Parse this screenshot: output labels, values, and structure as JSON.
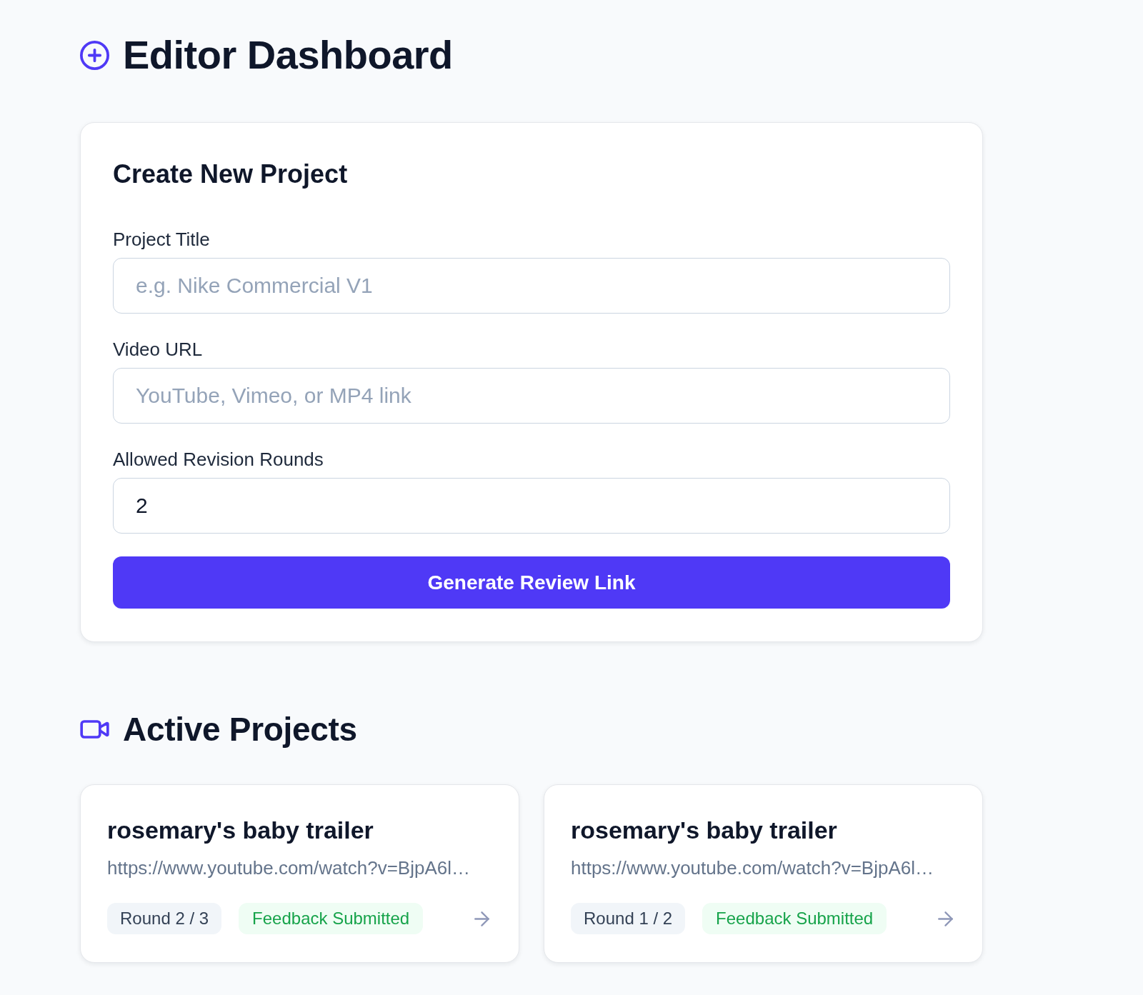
{
  "header": {
    "title": "Editor Dashboard"
  },
  "create_project": {
    "title": "Create New Project",
    "fields": [
      {
        "label": "Project Title",
        "placeholder": "e.g. Nike Commercial V1"
      },
      {
        "label": "Video URL",
        "placeholder": "YouTube, Vimeo, or MP4 link"
      },
      {
        "label": "Allowed Revision Rounds",
        "value": "2"
      }
    ],
    "submit_button": "Generate Review Link"
  },
  "active_projects": {
    "title": "Active Projects",
    "projects": [
      {
        "title": "rosemary's baby trailer",
        "url": "https://www.youtube.com/watch?v=BjpA6l…",
        "round": "Round 2 / 3",
        "status": "Feedback Submitted"
      },
      {
        "title": "rosemary's baby trailer",
        "url": "https://www.youtube.com/watch?v=BjpA6l…",
        "round": "Round 1 / 2",
        "status": "Feedback Submitted"
      }
    ]
  }
}
